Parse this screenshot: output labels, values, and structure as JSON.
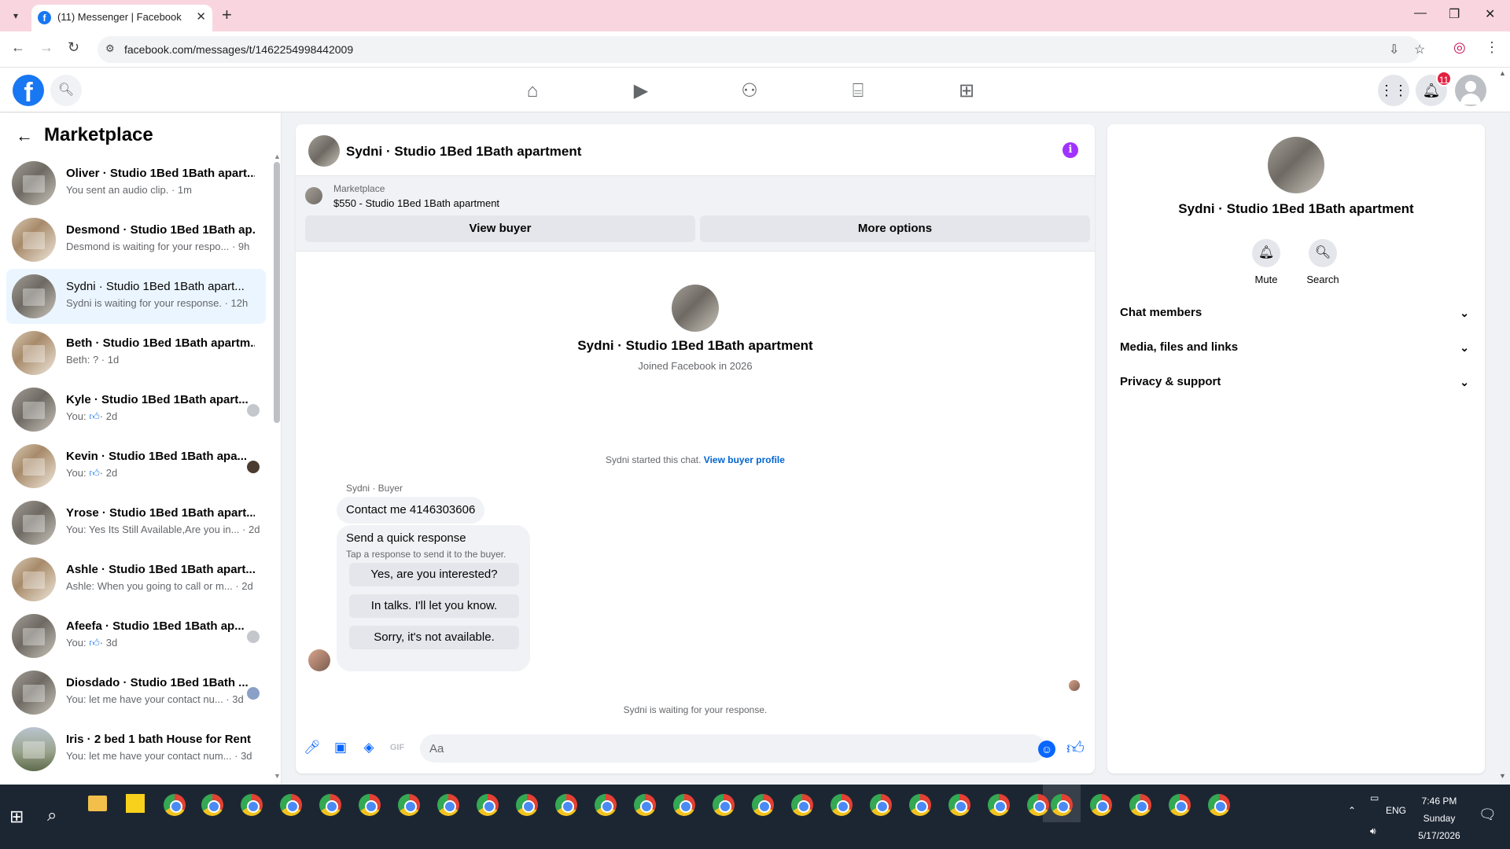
{
  "browser": {
    "tab_title": "(11) Messenger | Facebook",
    "url": "facebook.com/messages/t/1462254998442009"
  },
  "fb": {
    "notification_count": "11"
  },
  "sidebar": {
    "title": "Marketplace",
    "conversations": [
      {
        "name": "Oliver · Studio 1Bed 1Bath apart...",
        "preview": "You sent an audio clip. · 1m"
      },
      {
        "name": "Desmond · Studio 1Bed 1Bath ap...",
        "preview": "Desmond is waiting for your respo... · 9h"
      },
      {
        "name": "Sydni · Studio 1Bed 1Bath apart...",
        "preview": "Sydni is waiting for your response. · 12h"
      },
      {
        "name": "Beth · Studio 1Bed 1Bath apartm...",
        "preview": "Beth: ? · 1d"
      },
      {
        "name": "Kyle · Studio 1Bed 1Bath apart...",
        "preview_prefix": "You:",
        "preview": "· 2d"
      },
      {
        "name": "Kevin · Studio 1Bed 1Bath apa...",
        "preview_prefix": "You:",
        "preview": "· 2d"
      },
      {
        "name": "Yrose · Studio 1Bed 1Bath apart...",
        "preview": "You: Yes Its Still Available,Are you in... · 2d"
      },
      {
        "name": "Ashle · Studio 1Bed 1Bath apart...",
        "preview": "Ashle: When you going to call or m... · 2d"
      },
      {
        "name": "Afeefa · Studio 1Bed 1Bath ap...",
        "preview_prefix": "You:",
        "preview": "· 3d"
      },
      {
        "name": "Diosdado · Studio 1Bed 1Bath ...",
        "preview": "You: let me have your contact nu... · 3d"
      },
      {
        "name": "Iris · 2 bed 1 bath House for Rent",
        "preview": "You: let me have your contact num... · 3d"
      }
    ]
  },
  "chat": {
    "header_name": "Sydni · Studio 1Bed 1Bath apartment",
    "info_icon": "i",
    "marketplace_label": "Marketplace",
    "listing": "$550 - Studio 1Bed 1Bath apartment",
    "view_buyer": "View buyer",
    "more_options": "More options",
    "intro_name": "Sydni · Studio 1Bed 1Bath apartment",
    "intro_sub": "Joined Facebook in 2026",
    "started_text": "Sydni started this chat.",
    "buyer_profile_link": "View buyer profile",
    "sender_label": "Sydni · Buyer",
    "message": "Contact me 4146303606",
    "quick_title": "Send a quick response",
    "quick_sub": "Tap a response to send it to the buyer.",
    "quick_responses": [
      "Yes, are you interested?",
      "In talks. I'll let you know.",
      "Sorry, it's not available."
    ],
    "waiting": "Sydni is waiting for your response.",
    "input_placeholder": "Aa"
  },
  "info_panel": {
    "name": "Sydni · Studio 1Bed 1Bath apartment",
    "mute": "Mute",
    "search": "Search",
    "sections": [
      "Chat members",
      "Media, files and links",
      "Privacy & support"
    ]
  },
  "taskbar": {
    "lang": "ENG",
    "time": "7:46 PM",
    "day": "Sunday",
    "date": "5/17/2026"
  },
  "icons": [
    "chevron-down-icon",
    "facebook-icon",
    "close-icon",
    "plus-icon",
    "back-icon",
    "forward-icon",
    "reload-icon",
    "site-settings-icon",
    "install-icon",
    "star-icon",
    "profile-icon",
    "menu-icon",
    "search-icon",
    "home-icon",
    "video-icon",
    "groups-icon",
    "marketplace-icon",
    "gaming-icon",
    "apps-grid-icon",
    "bell-icon",
    "info-icon",
    "mic-icon",
    "photo-icon",
    "sticker-icon",
    "gif-icon",
    "emoji-icon",
    "like-icon",
    "windows-icon"
  ]
}
